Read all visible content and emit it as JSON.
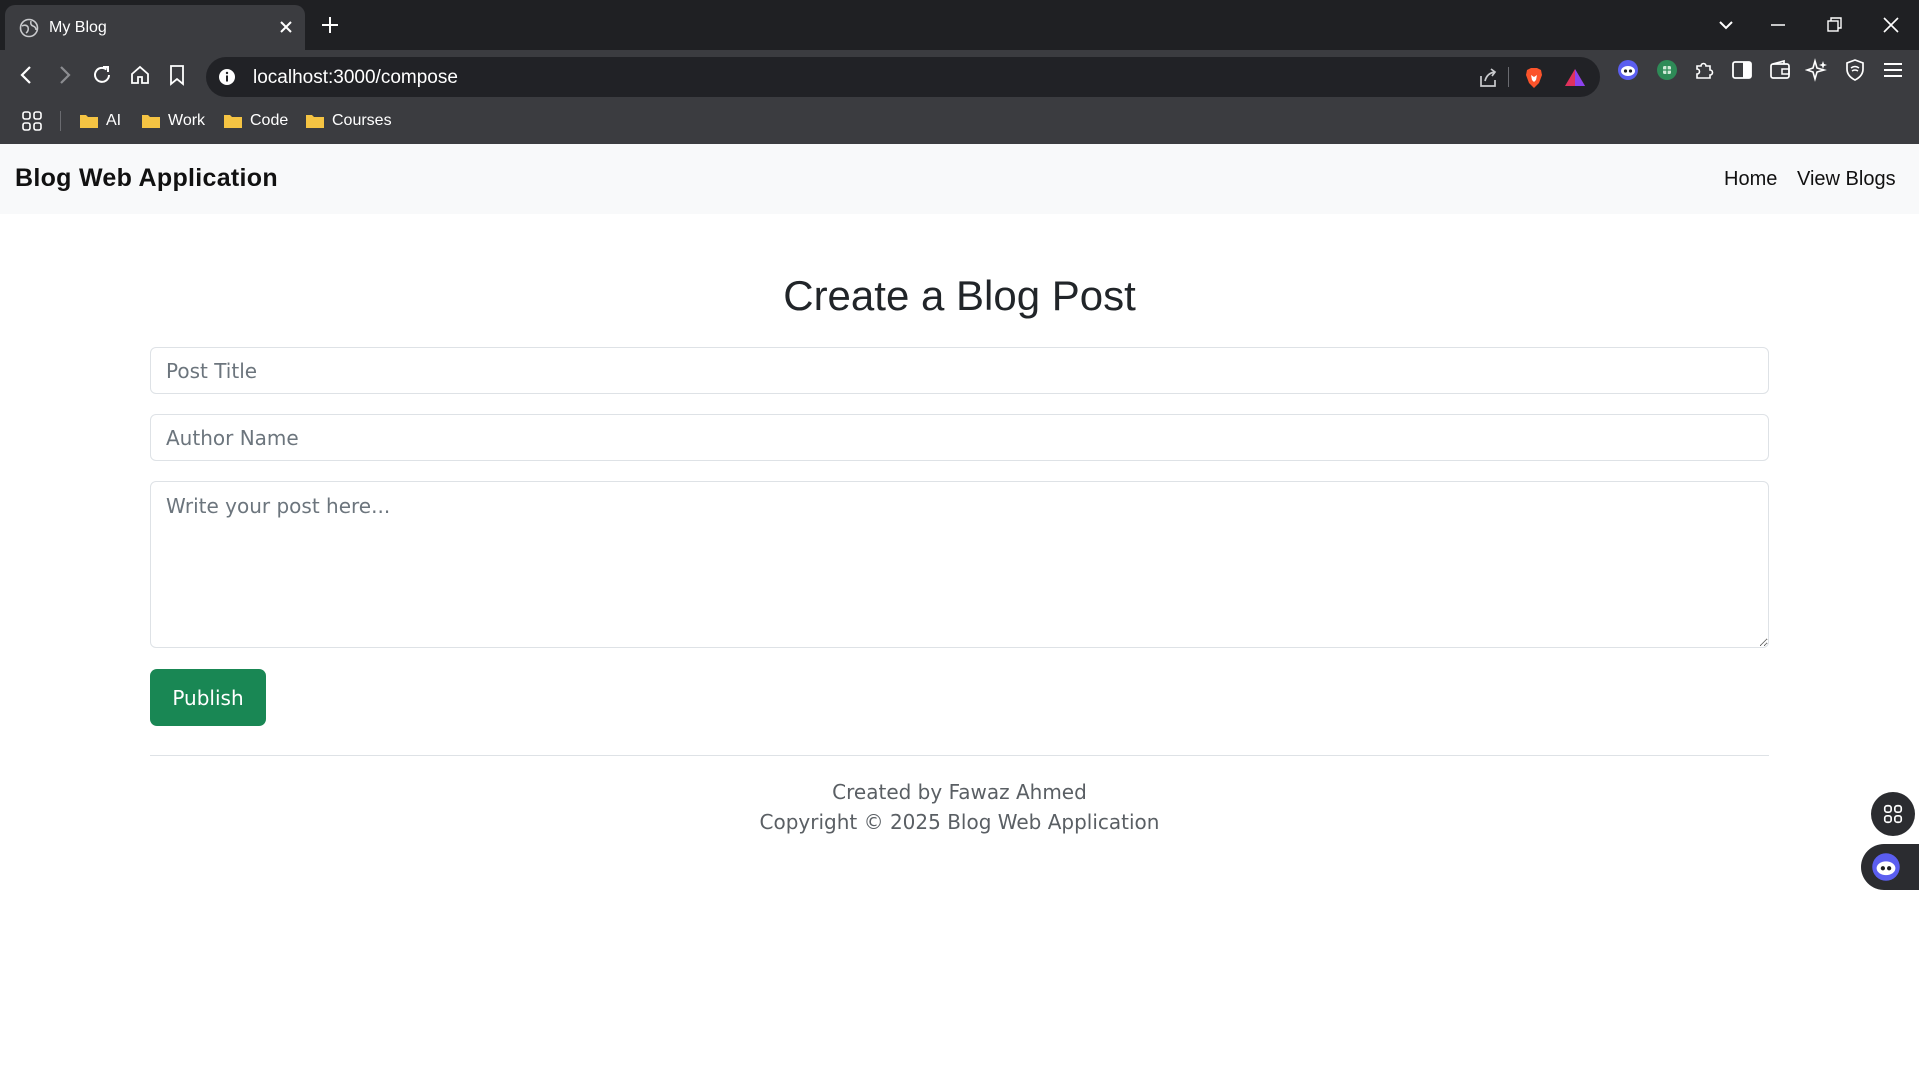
{
  "browser": {
    "tab_title": "My Blog",
    "url": "localhost:3000/compose",
    "bookmarks": [
      "AI",
      "Work",
      "Code",
      "Courses"
    ]
  },
  "navbar": {
    "brand": "Blog Web Application",
    "links": [
      "Home",
      "View Blogs"
    ]
  },
  "form": {
    "heading": "Create a Blog Post",
    "title_placeholder": "Post Title",
    "author_placeholder": "Author Name",
    "body_placeholder": "Write your post here...",
    "submit_label": "Publish"
  },
  "footer": {
    "credit": "Created by Fawaz Ahmed",
    "copyright": "Copyright © 2025 Blog Web Application"
  },
  "colors": {
    "accent": "#198754",
    "navbar_bg": "#f8f9fa",
    "chrome_dark": "#1f2023",
    "chrome_mid": "#3b3c40"
  },
  "icons": [
    "globe-icon",
    "close-icon",
    "plus-icon",
    "chevron-down-icon",
    "minimize-icon",
    "restore-icon",
    "back-icon",
    "forward-icon",
    "reload-icon",
    "home-icon",
    "bookmark-icon",
    "info-icon",
    "share-icon",
    "brave-shield-icon",
    "rewards-icon",
    "extension-icon",
    "sidebar-icon",
    "wallet-icon",
    "leo-icon",
    "vpn-icon",
    "menu-icon",
    "apps-grid-icon",
    "folder-icon"
  ]
}
